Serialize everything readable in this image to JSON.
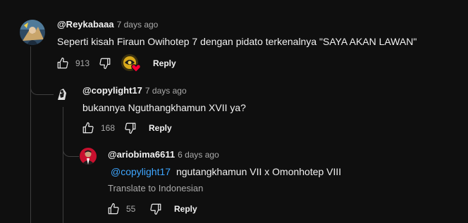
{
  "comments": [
    {
      "author": "@Reykabaaa",
      "time": "7 days ago",
      "text": "Seperti kisah Firaun Owihotep 7 dengan pidato terkenalnya \"SAYA AKAN LAWAN\"",
      "likes": "913",
      "reply_label": "Reply",
      "avatar_icon": "user-avatar-icon",
      "hearted": true
    },
    {
      "author": "@copylight17",
      "time": "7 days ago",
      "text": "bukannya Nguthangkhamun XVII ya?",
      "likes": "168",
      "reply_label": "Reply",
      "avatar_icon": "user-avatar-icon"
    },
    {
      "author": "@ariobima6611",
      "time": "6 days ago",
      "mention": "@copylight17",
      "text": "ngutangkhamun VII x Omonhotep VIII",
      "translate_label": "Translate to Indonesian",
      "likes": "55",
      "reply_label": "Reply",
      "avatar_icon": "user-avatar-icon"
    }
  ],
  "colors": {
    "background": "#0f0f0f",
    "text": "#f1f1f1",
    "secondary": "#aaaaaa",
    "mention": "#3ea6ff",
    "thread_line": "#3f3f3f",
    "heart": "#ff0033"
  }
}
